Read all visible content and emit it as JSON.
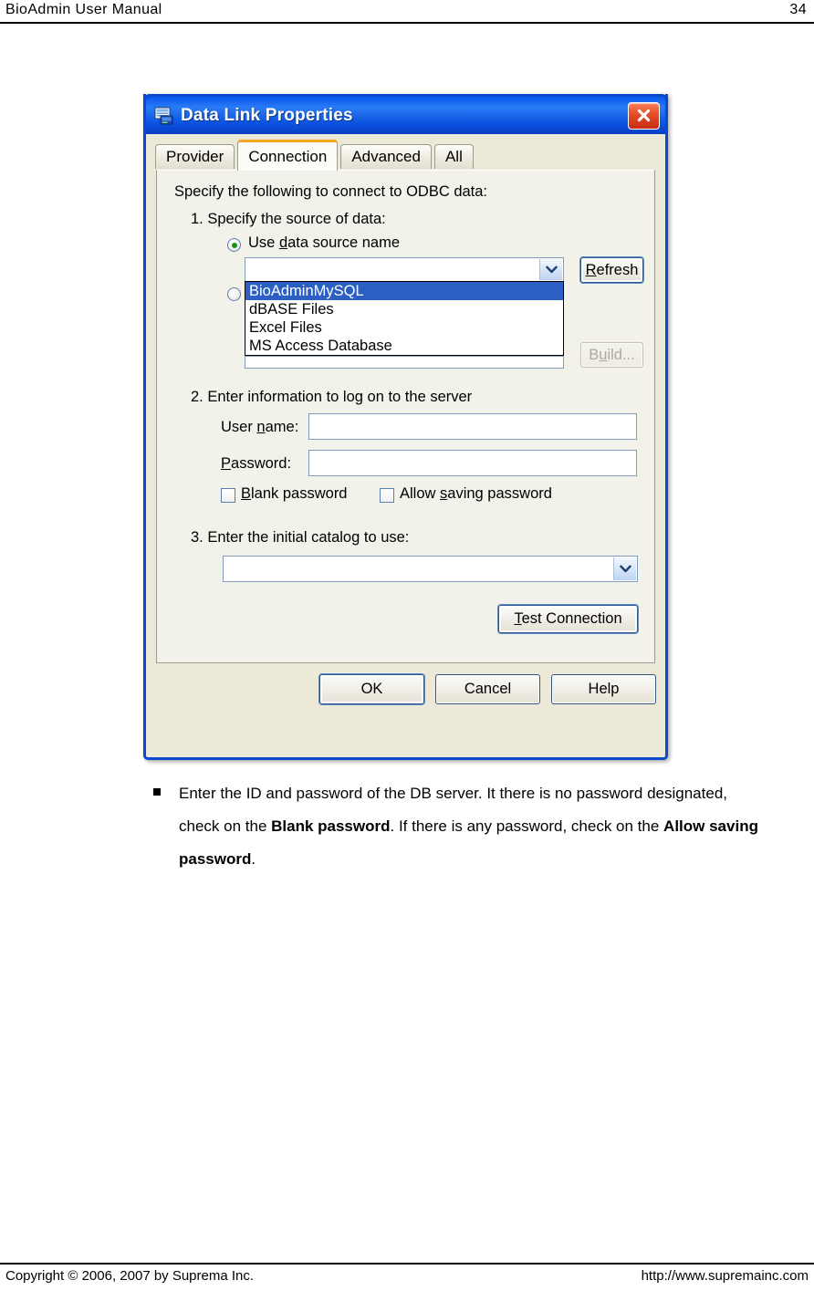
{
  "page": {
    "header_title": "BioAdmin  User  Manual",
    "page_number": "34",
    "footer_copyright": "Copyright © 2006, 2007 by Suprema Inc.",
    "footer_url": "http://www.supremainc.com"
  },
  "dialog": {
    "title": "Data Link Properties",
    "icon": "data-link-icon",
    "close_label": "×",
    "tabs": [
      {
        "label": "Provider",
        "active": false
      },
      {
        "label": "Connection",
        "active": true
      },
      {
        "label": "Advanced",
        "active": false
      },
      {
        "label": "All",
        "active": false
      }
    ],
    "intro": "Specify the following to connect to ODBC data:",
    "step1": {
      "label": "1. Specify the source of data:",
      "radio_dsn_label": "Use data source name",
      "radio_dsn_selected": true,
      "radio_connstring_selected": false,
      "dsn_value": "",
      "refresh_label": "Refresh",
      "build_label": "Build...",
      "build_disabled": true,
      "dropdown_open": true,
      "dropdown_options": [
        "BioAdminMySQL",
        "dBASE Files",
        "Excel Files",
        "MS Access Database"
      ],
      "dropdown_selected": "BioAdminMySQL"
    },
    "step2": {
      "label": "2. Enter information to log on to the server",
      "username_label": "User name:",
      "username_value": "",
      "password_label": "Password:",
      "password_value": "",
      "blank_password_label": "Blank password",
      "blank_password_checked": false,
      "allow_saving_label": "Allow saving password",
      "allow_saving_checked": false
    },
    "step3": {
      "label": "3. Enter the initial catalog to use:",
      "catalog_value": "",
      "test_connection_label": "Test Connection"
    },
    "footer_buttons": {
      "ok_label": "OK",
      "cancel_label": "Cancel",
      "help_label": "Help"
    }
  },
  "body": {
    "bullet_part1": "Enter the ID and password of the DB server. It there is no password designated, check on the ",
    "bullet_bold1": "Blank password",
    "bullet_part2": ". If there is any password, check on the ",
    "bullet_bold2": "Allow saving password",
    "bullet_part3": "."
  },
  "colors": {
    "titlebar_blue": "#0a56e8",
    "tab_active_accent": "#f5a623",
    "dialog_face": "#ece9d8",
    "selection_blue": "#2b5fc4",
    "close_red": "#c62c12"
  }
}
